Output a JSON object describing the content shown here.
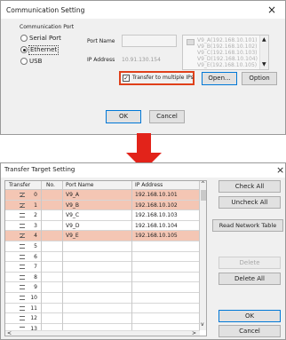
{
  "comm": {
    "title": "Communication Setting",
    "close": "×",
    "group_label": "Communication Port",
    "options": [
      "Serial Port",
      "Ethernet",
      "USB"
    ],
    "selected": "Ethernet",
    "port_name_label": "Port Name",
    "ip_label": "IP Address",
    "ip_value": "10.91.130.154",
    "ip_list": [
      "V9_A(192.168.10.101)",
      "V9_B(192.168.10.102)",
      "V9_C(192.168.10.103)",
      "V9_D(192.168.10.104)",
      "V9_E(192.168.10.105)"
    ],
    "transfer_label": "Transfer to multiple IPs",
    "transfer_checked": true,
    "open_btn": "Open...",
    "option_btn": "Option",
    "ok_btn": "OK",
    "cancel_btn": "Cancel",
    "highlight_color": "#e0401a"
  },
  "arrow": {
    "color": "#e2231a"
  },
  "target": {
    "title": "Transfer Target Setting",
    "close": "×",
    "columns": [
      "Transfer",
      "No.",
      "Port Name",
      "IP Address"
    ],
    "rows": [
      {
        "checked": true,
        "no": "0",
        "name": "V9_A",
        "ip": "192.168.10.101",
        "hl": true
      },
      {
        "checked": true,
        "no": "1",
        "name": "V9_B",
        "ip": "192.168.10.102",
        "hl": true
      },
      {
        "checked": false,
        "no": "2",
        "name": "V9_C",
        "ip": "192.168.10.103",
        "hl": false
      },
      {
        "checked": false,
        "no": "3",
        "name": "V9_D",
        "ip": "192.168.10.104",
        "hl": false
      },
      {
        "checked": true,
        "no": "4",
        "name": "V9_E",
        "ip": "192.168.10.105",
        "hl": true
      },
      {
        "checked": false,
        "no": "5",
        "name": "",
        "ip": "",
        "hl": false
      },
      {
        "checked": false,
        "no": "6",
        "name": "",
        "ip": "",
        "hl": false
      },
      {
        "checked": false,
        "no": "7",
        "name": "",
        "ip": "",
        "hl": false
      },
      {
        "checked": false,
        "no": "8",
        "name": "",
        "ip": "",
        "hl": false
      },
      {
        "checked": false,
        "no": "9",
        "name": "",
        "ip": "",
        "hl": false
      },
      {
        "checked": false,
        "no": "10",
        "name": "",
        "ip": "",
        "hl": false
      },
      {
        "checked": false,
        "no": "11",
        "name": "",
        "ip": "",
        "hl": false
      },
      {
        "checked": false,
        "no": "12",
        "name": "",
        "ip": "",
        "hl": false
      },
      {
        "checked": false,
        "no": "13",
        "name": "",
        "ip": "",
        "hl": false
      }
    ],
    "buttons": {
      "check_all": "Check All",
      "uncheck_all": "Uncheck All",
      "read": "Read Network Table",
      "delete": "Delete",
      "delete_all": "Delete All",
      "ok": "OK",
      "cancel": "Cancel"
    },
    "highlight_color": "#f4c6b4"
  }
}
